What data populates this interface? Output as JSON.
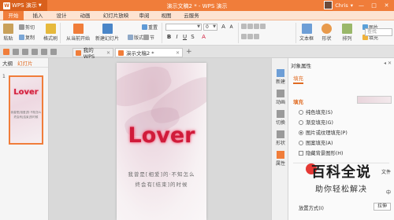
{
  "titlebar": {
    "app_name": "WPS 演示",
    "logo": "W",
    "document_title": "演示文稿2 * - WPS 演示",
    "user_name": "Chris",
    "controls": {
      "minimize": "—",
      "maximize": "□",
      "close": "✕"
    }
  },
  "menu": {
    "tabs": [
      "开始",
      "插入",
      "设计",
      "动画",
      "幻灯片放映",
      "审阅",
      "视图",
      "云服务"
    ],
    "active": "开始"
  },
  "ribbon": {
    "paste": "粘贴",
    "cut": "剪切",
    "copy": "复制",
    "format_painter": "格式刷",
    "play_current": "从当前开始",
    "new_slide": "新建幻灯片",
    "layout": "版式",
    "section": "节",
    "reset": "重置",
    "font_size": "0",
    "textbox": "文本框",
    "shape": "形状",
    "arrange": "排列",
    "image": "图片",
    "fill": "填充",
    "search_placeholder": "查找"
  },
  "doc_tabs": {
    "mywps": "我的WPS",
    "current": "演示文稿2 *",
    "add": "+"
  },
  "left_panel": {
    "tab_outline": "大纲",
    "tab_slides": "幻灯片",
    "slide_number": "1",
    "thumb_title": "Lover",
    "thumb_line1": "我曾是[相爱]的·不知怎么",
    "thumb_line2": "终会有[结束]的时候"
  },
  "slide": {
    "title": "Lover",
    "line1": "我曾是[相爱]的·不知怎么",
    "line2": "终会有[结束]的时候"
  },
  "side_tools": [
    "新建",
    "动画",
    "切换",
    "形状",
    "属性"
  ],
  "properties": {
    "header": "对象属性",
    "tab_fill": "填充",
    "section_fill": "填充",
    "options": [
      {
        "label": "纯色填充(S)",
        "selected": false
      },
      {
        "label": "渐变填充(G)",
        "selected": false
      },
      {
        "label": "图片或纹理填充(P)",
        "selected": true
      },
      {
        "label": "图案填充(A)",
        "selected": false
      }
    ],
    "hide_background": "隐藏背景图形(H)",
    "right_label_1": "文件",
    "right_label_2": "中",
    "placement_label": "放置方式(I)",
    "placement_value": "拉伸",
    "watermark_line1": "百科全说",
    "watermark_line2": "助你轻松解决"
  },
  "colors": {
    "accent": "#f07d3a",
    "title_red": "#d01b3a"
  }
}
